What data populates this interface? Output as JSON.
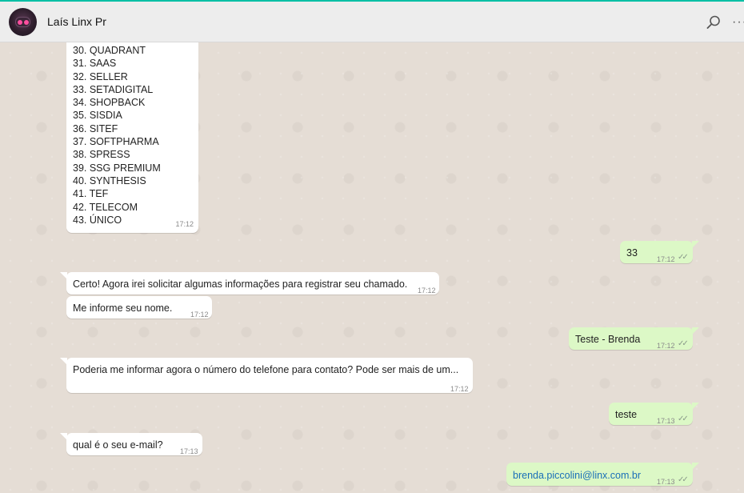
{
  "header": {
    "contact_name": "Laís Linx Pr"
  },
  "icons": {
    "avatar": "robot-avatar",
    "search": "search-icon",
    "menu": "more-options-icon"
  },
  "colors": {
    "accent": "#00bfa5",
    "incoming": "#ffffff",
    "outgoing": "#dcf8c6",
    "chat_bg": "#e5ddd5",
    "link": "#1a6fb8"
  },
  "messages": {
    "list": {
      "items": [
        "30. QUADRANT",
        "31. SAAS",
        "32. SELLER",
        "33. SETADIGITAL",
        "34. SHOPBACK",
        "35. SISDIA",
        "36. SITEF",
        "37. SOFTPHARMA",
        "38. SPRESS",
        "39. SSG PREMIUM",
        "40. SYNTHESIS",
        "41. TEF",
        "42. TELECOM",
        "43. ÚNICO"
      ],
      "time": "17:12"
    },
    "m1": {
      "text": "33",
      "time": "17:12",
      "ticks": "✓✓"
    },
    "m2": {
      "text": "Certo! Agora irei solicitar algumas informações para registrar seu chamado.",
      "time": "17:12"
    },
    "m3": {
      "text": "Me informe seu nome.",
      "time": "17:12"
    },
    "m4": {
      "text": "Teste - Brenda",
      "time": "17:12",
      "ticks": "✓✓"
    },
    "m5": {
      "text": "Poderia me informar agora o número do telefone para contato? Pode ser mais de um...",
      "time": "17:12"
    },
    "m6": {
      "text": "teste",
      "time": "17:13",
      "ticks": "✓✓"
    },
    "m7": {
      "text": "qual é o seu e-mail?",
      "time": "17:13"
    },
    "m8": {
      "text": "brenda.piccolini@linx.com.br",
      "time": "17:13",
      "ticks": "✓✓"
    }
  }
}
